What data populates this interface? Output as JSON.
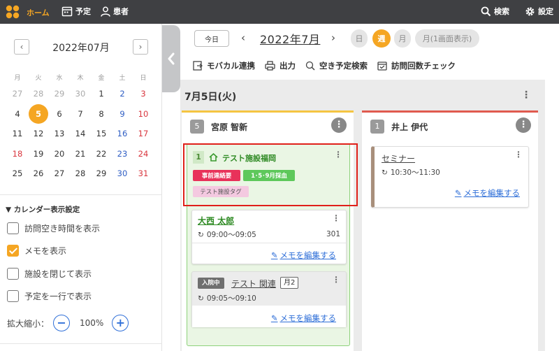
{
  "topbar": {
    "home": "ホーム",
    "schedule": "予定",
    "patients": "患者",
    "search": "検索",
    "settings": "設定"
  },
  "calendar": {
    "month_label": "2022年07月",
    "weekdays": [
      "月",
      "火",
      "水",
      "木",
      "金",
      "土",
      "日"
    ],
    "weeks": [
      [
        "27",
        "28",
        "29",
        "30",
        "1",
        "2",
        "3"
      ],
      [
        "4",
        "5",
        "6",
        "7",
        "8",
        "9",
        "10"
      ],
      [
        "11",
        "12",
        "13",
        "14",
        "15",
        "16",
        "17"
      ],
      [
        "18",
        "19",
        "20",
        "21",
        "22",
        "23",
        "24"
      ],
      [
        "25",
        "26",
        "27",
        "28",
        "29",
        "30",
        "31"
      ]
    ],
    "selected": "5"
  },
  "display_settings": {
    "title": "▼ カレンダー表示設定",
    "options": [
      {
        "label": "訪問空き時間を表示",
        "checked": false
      },
      {
        "label": "メモを表示",
        "checked": true
      },
      {
        "label": "施設を閉じて表示",
        "checked": false
      },
      {
        "label": "予定を一行で表示",
        "checked": false
      }
    ],
    "zoom_label": "拡大縮小：",
    "zoom_value": "100%"
  },
  "header": {
    "today": "今日",
    "date": "2022年7月",
    "views": [
      "日",
      "週",
      "月",
      "月(1画面表示)"
    ],
    "active_view": "週"
  },
  "toolbar": {
    "mobacal": "モバカル連携",
    "output": "出力",
    "free_search": "空き予定検索",
    "visit_check": "訪問回数チェック"
  },
  "day": {
    "title": "7月5日(火)",
    "columns": [
      {
        "num": "5",
        "name": "宮原 智新",
        "accent": "#f5c542",
        "facility": {
          "num": "1",
          "name": "テスト施設福岡",
          "badges": [
            "事前連絡要",
            "1･5･9月採血"
          ],
          "tag": "テスト施設タグ",
          "visits": [
            {
              "patient": "大西 太郎",
              "time": "09:00〜09:05",
              "room": "301",
              "memo": "メモを編集する"
            },
            {
              "status": "入院中",
              "patient": "テスト 関連",
              "freq": "月2",
              "time": "09:05〜09:10",
              "memo": "メモを編集する"
            }
          ]
        }
      },
      {
        "num": "1",
        "name": "井上 伊代",
        "accent": "#e05a4f",
        "event": {
          "title": "セミナー",
          "time": "10:30〜11:30",
          "memo": "メモを編集する"
        }
      }
    ]
  }
}
